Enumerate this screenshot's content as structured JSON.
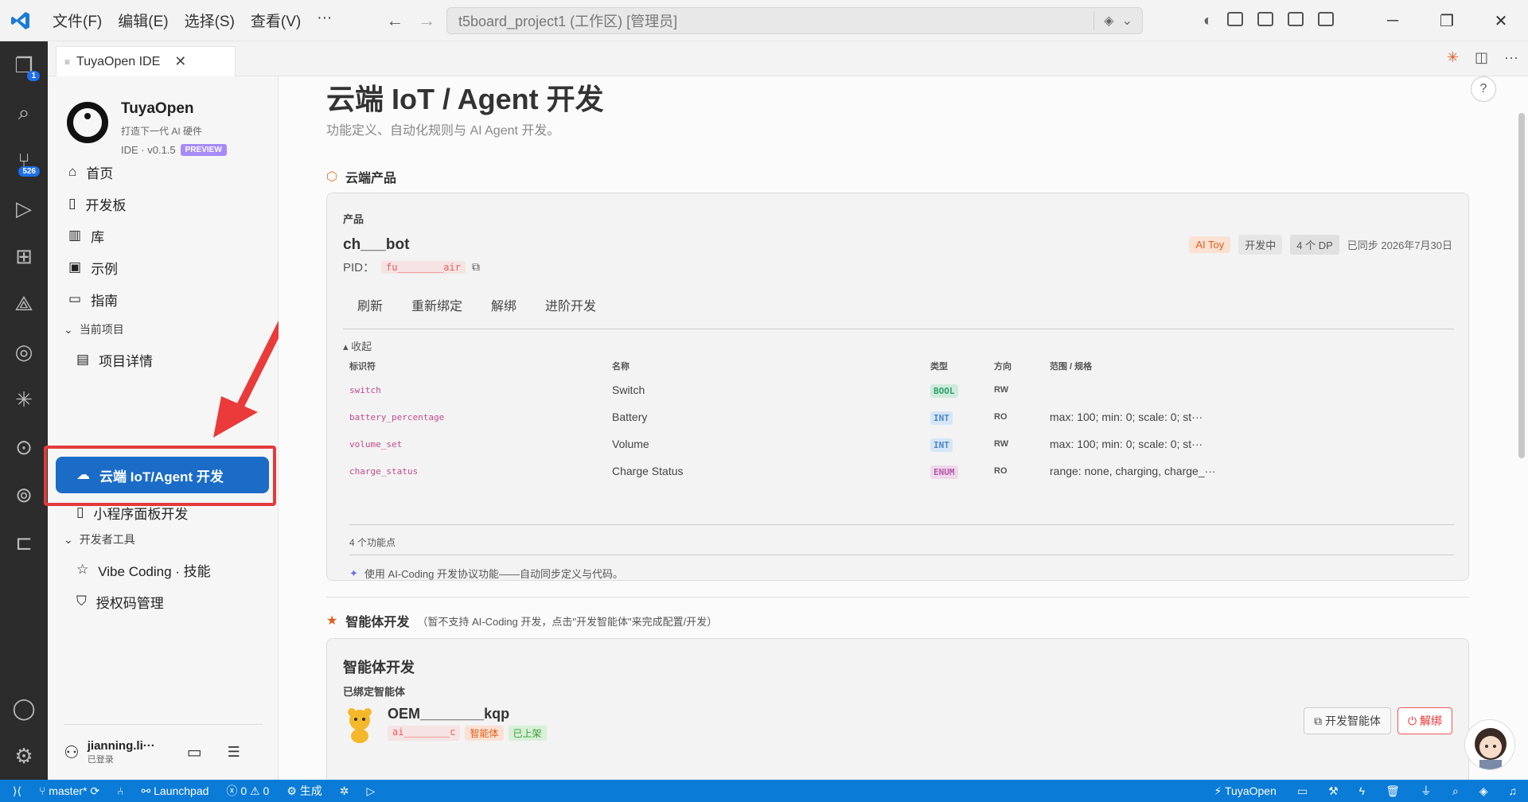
{
  "titlebar": {
    "menu": [
      "文件(F)",
      "编辑(E)",
      "选择(S)",
      "查看(V)",
      "···"
    ],
    "search": "t5board_project1 (工作区) [管理员]"
  },
  "activitybar": {
    "explorer_badge": "1",
    "scm_badge": "526"
  },
  "tab": {
    "label": "TuyaOpen IDE"
  },
  "sidebar": {
    "brand_name": "TuyaOpen",
    "brand_sub": "打造下一代 AI 硬件",
    "brand_ver": "IDE · v0.1.5",
    "preview": "PREVIEW",
    "nav": [
      "首页",
      "开发板",
      "库",
      "示例",
      "指南"
    ],
    "group_current": "当前项目",
    "project_detail": "项目详情",
    "cloud_active": "云端 IoT/Agent 开发",
    "mini_panel": "小程序面板开发",
    "group_tools": "开发者工具",
    "vibe": "Vibe Coding · 技能",
    "license": "授权码管理",
    "user_name": "jianning.li···",
    "user_status": "已登录"
  },
  "main": {
    "title": "云端 IoT / Agent 开发",
    "subtitle": "功能定义、自动化规则与 AI Agent 开发。",
    "help": "?",
    "product_section": "云端产品",
    "product_label": "产品",
    "product_name": "ch___bot",
    "pid_label": "PID：",
    "pid_value": "fu________air",
    "tag_ai": "AI Toy",
    "tag_dev": "开发中",
    "tag_dp": "4 个 DP",
    "synced": "已同步 2026年7月30日",
    "actions": [
      "刷新",
      "重新绑定",
      "解绑",
      "进阶开发"
    ],
    "collapse": "收起",
    "table_headers": [
      "标识符",
      "名称",
      "类型",
      "方向",
      "范围 / 规格"
    ],
    "table_rows": [
      {
        "id": "switch",
        "name": "Switch",
        "type": "BOOL",
        "dir": "RW",
        "range": ""
      },
      {
        "id": "battery_percentage",
        "name": "Battery",
        "type": "INT",
        "dir": "RO",
        "range": "max: 100; min: 0; scale: 0; st···"
      },
      {
        "id": "volume_set",
        "name": "Volume",
        "type": "INT",
        "dir": "RW",
        "range": "max: 100; min: 0; scale: 0; st···"
      },
      {
        "id": "charge_status",
        "name": "Charge Status",
        "type": "ENUM",
        "dir": "RO",
        "range": "range: none, charging, charge_···"
      }
    ],
    "dp_count": "4 个功能点",
    "ai_note": "使用 AI-Coding 开发协议功能——自动同步定义与代码。",
    "agent_section": "智能体开发",
    "agent_section_note": "（暂不支持 AI-Coding 开发，点击\"开发智能体\"来完成配置/开发）",
    "agent_title": "智能体开发",
    "agent_bound": "已绑定智能体",
    "agent_name": "OEM________kqp",
    "agent_id": "ai________c",
    "agent_type": "智能体",
    "agent_status": "已上架",
    "btn_develop": "开发智能体",
    "btn_unbind": "解绑"
  },
  "statusbar": {
    "branch": "master*",
    "launchpad": "Launchpad",
    "errors": "0",
    "warnings": "0",
    "build": "生成",
    "tuya": "TuyaOpen"
  }
}
